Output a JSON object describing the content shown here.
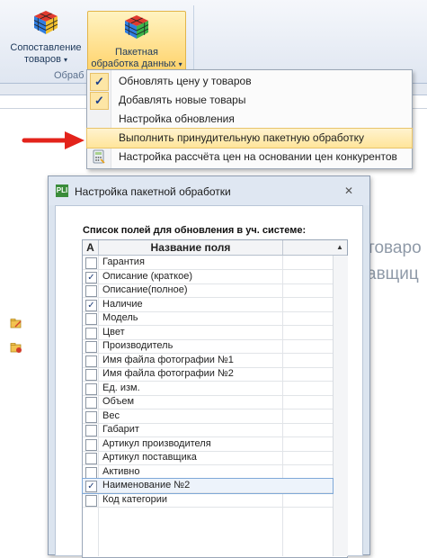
{
  "ribbon": {
    "compare_label_1": "Сопоставление",
    "compare_label_2": "товаров",
    "batch_label_1": "Пакетная",
    "batch_label_2": "обработка данных",
    "group_label": "Обраб",
    "accent": "#ffd36b"
  },
  "menu": {
    "items": [
      {
        "label": "Обновлять цену у товаров",
        "checked": true
      },
      {
        "label": "Добавлять новые товары",
        "checked": true
      },
      {
        "label": "Настройка обновления",
        "checked": false
      },
      {
        "label": "Выполнить принудительную пакетную обработку",
        "highlighted": true
      },
      {
        "label": "Настройка рассчёта цен на основании цен конкурентов",
        "icon": "calculator-icon"
      }
    ]
  },
  "background": {
    "text_1": "товаро",
    "text_2": "авщиц"
  },
  "dialog": {
    "title": "Настройка пакетной обработки",
    "logo": "PLI",
    "close": "✕",
    "list_caption": "Список полей для обновления в уч. системе:",
    "columns": {
      "a": "A",
      "name": "Название поля"
    },
    "rows": [
      {
        "name": "Гарантия",
        "checked": false
      },
      {
        "name": "Описание (краткое)",
        "checked": true
      },
      {
        "name": "Описание(полное)",
        "checked": false
      },
      {
        "name": "Наличие",
        "checked": true
      },
      {
        "name": "Модель",
        "checked": false
      },
      {
        "name": "Цвет",
        "checked": false
      },
      {
        "name": "Производитель",
        "checked": false
      },
      {
        "name": "Имя файла фотографии №1",
        "checked": false
      },
      {
        "name": "Имя файла фотографии №2",
        "checked": false
      },
      {
        "name": "Ед. изм.",
        "checked": false
      },
      {
        "name": "Объем",
        "checked": false
      },
      {
        "name": "Вес",
        "checked": false
      },
      {
        "name": "Габарит",
        "checked": false
      },
      {
        "name": "Артикул производителя",
        "checked": false
      },
      {
        "name": "Артикул поставщика",
        "checked": false
      },
      {
        "name": "Активно",
        "checked": false
      },
      {
        "name": "Наименование №2",
        "checked": true,
        "selected": true
      },
      {
        "name": "Код категории",
        "checked": false
      }
    ]
  }
}
